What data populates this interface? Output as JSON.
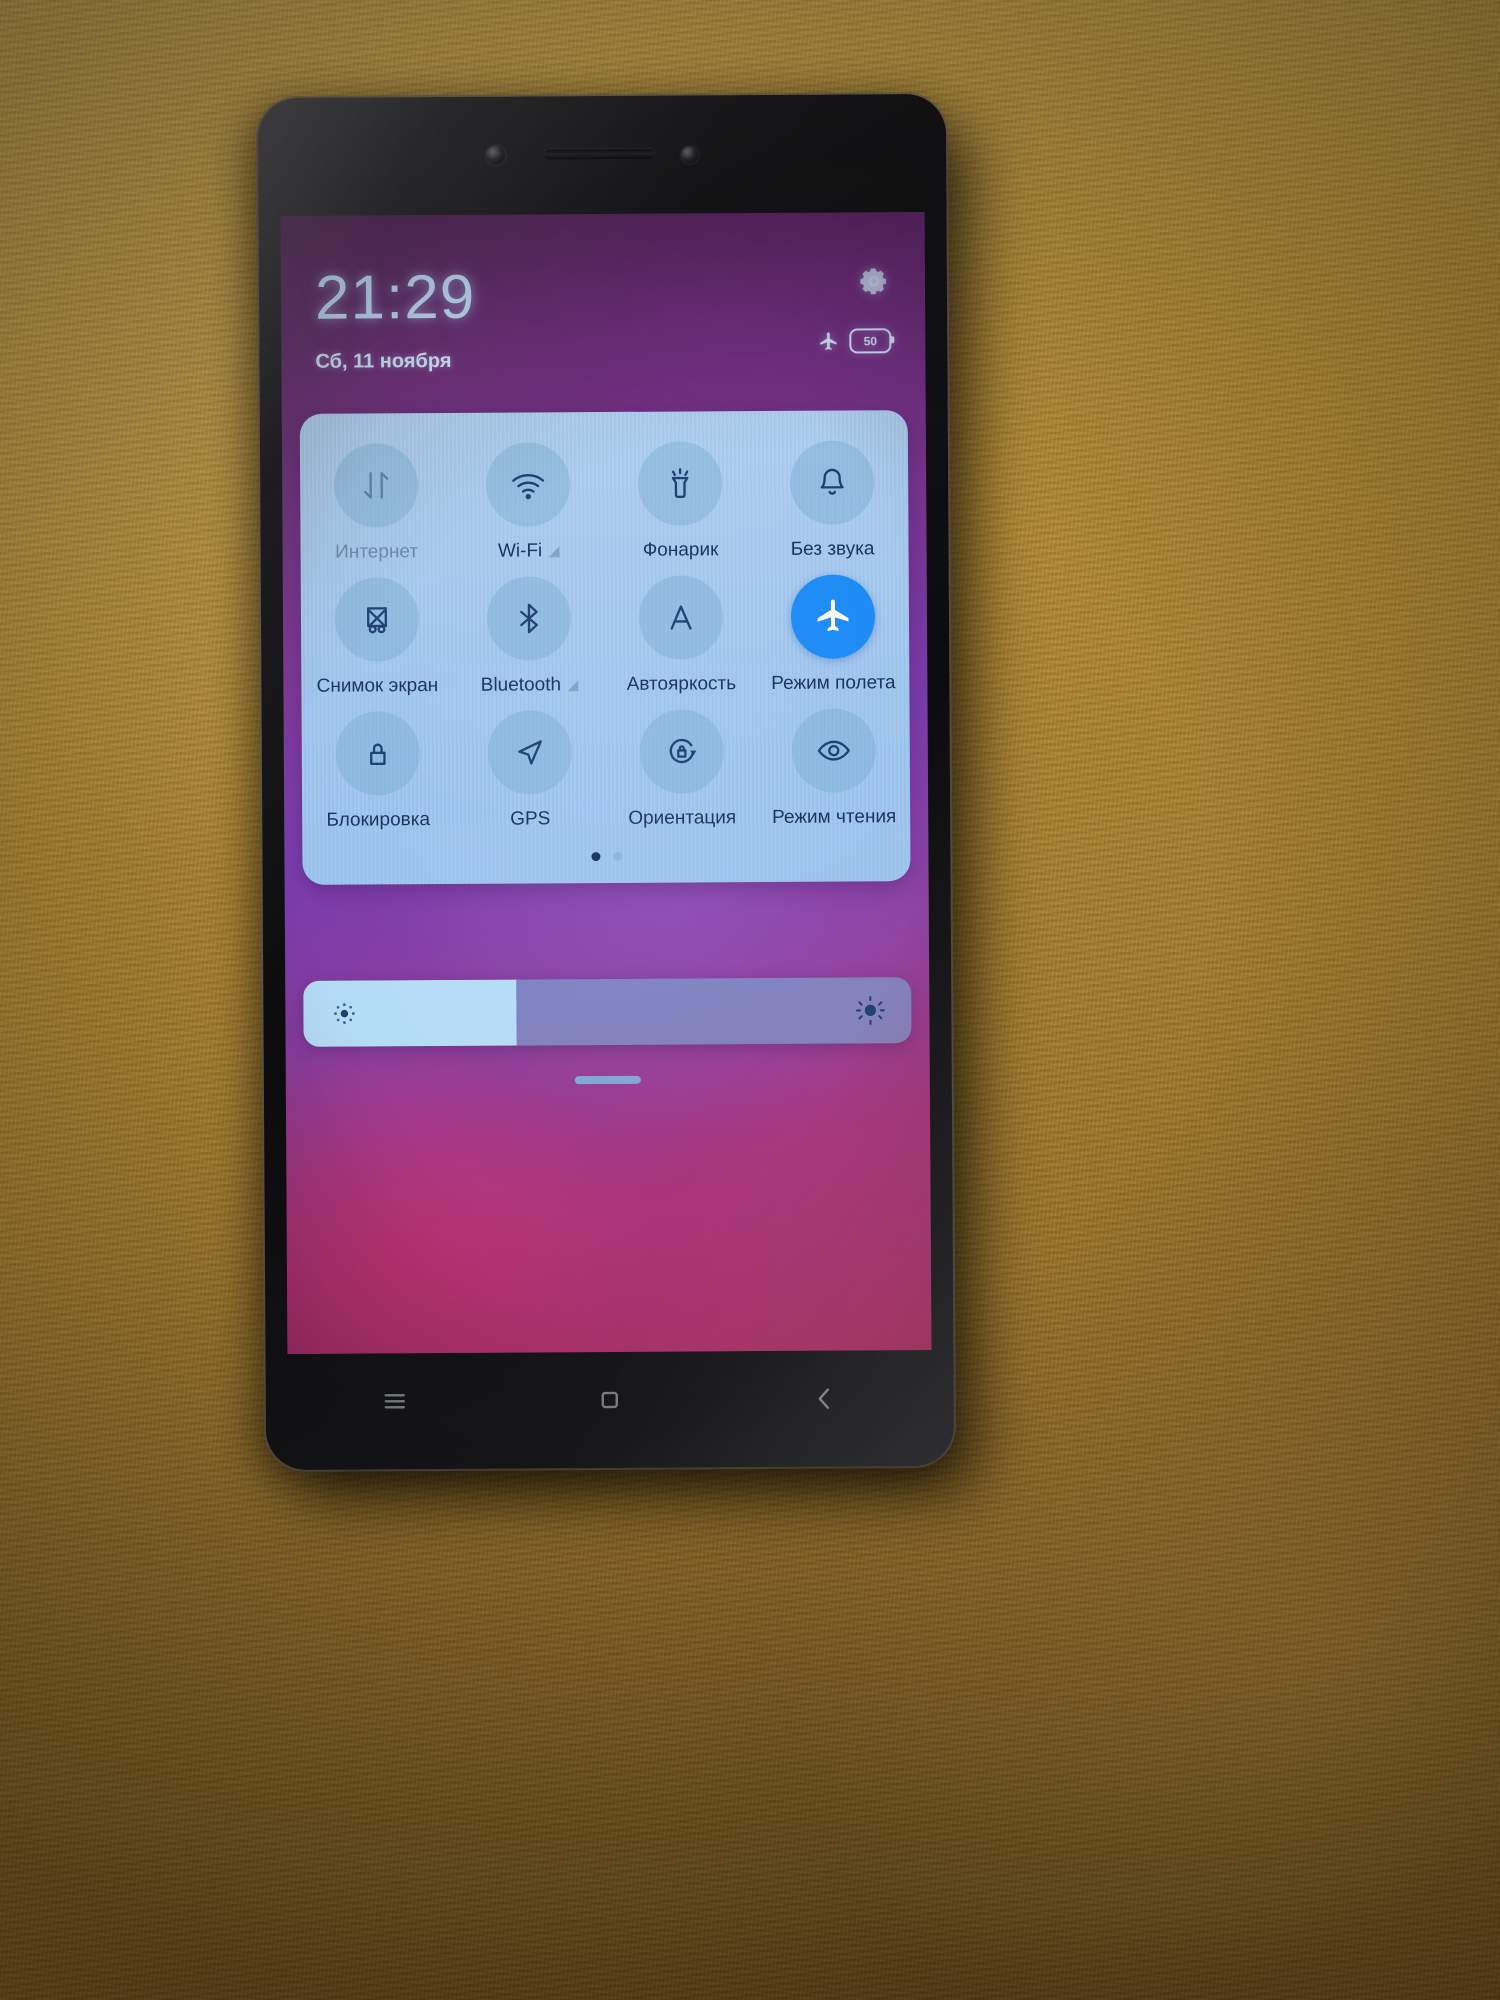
{
  "device": {
    "name": "smartphone",
    "os_skin": "MIUI quick settings (Russian locale)"
  },
  "lockscreen": {
    "time": "21:29",
    "date": "Сб, 11 ноября",
    "settings_icon": "gear-icon",
    "status": {
      "airplane_icon": "airplane-icon",
      "battery_percent": "50",
      "battery_icon": "battery-icon"
    }
  },
  "quick_settings": {
    "tiles": [
      {
        "label": "Интернет",
        "icon": "data-transfer-icon",
        "state": "disabled",
        "arrow": false
      },
      {
        "label": "Wi-Fi",
        "icon": "wifi-icon",
        "state": "off",
        "arrow": true
      },
      {
        "label": "Фонарик",
        "icon": "flashlight-icon",
        "state": "off",
        "arrow": false
      },
      {
        "label": "Без звука",
        "icon": "bell-icon",
        "state": "off",
        "arrow": false
      },
      {
        "label": "Снимок экран",
        "icon": "screenshot-icon",
        "state": "off",
        "arrow": false
      },
      {
        "label": "Bluetooth",
        "icon": "bluetooth-icon",
        "state": "off",
        "arrow": true
      },
      {
        "label": "Автояркость",
        "icon": "auto-brightness-icon",
        "state": "off",
        "arrow": false
      },
      {
        "label": "Режим полета",
        "icon": "airplane-icon",
        "state": "on",
        "arrow": false
      },
      {
        "label": "Блокировка",
        "icon": "lock-icon",
        "state": "off",
        "arrow": false
      },
      {
        "label": "GPS",
        "icon": "location-arrow-icon",
        "state": "off",
        "arrow": false
      },
      {
        "label": "Ориентация",
        "icon": "rotation-lock-icon",
        "state": "off",
        "arrow": false
      },
      {
        "label": "Режим чтения",
        "icon": "eye-icon",
        "state": "off",
        "arrow": false
      }
    ],
    "pages": 2,
    "active_page": 1
  },
  "brightness": {
    "value_percent": 35,
    "low_icon": "brightness-low-icon",
    "high_icon": "brightness-high-icon"
  },
  "nav_bar": {
    "keys": [
      "menu-icon",
      "home-icon",
      "back-icon"
    ]
  },
  "colors": {
    "accent_active": "#1e8bf5",
    "panel_bg": "#a9d3f3",
    "icon_ink": "#1d3f70",
    "clock_text": "#bfd9f5"
  }
}
